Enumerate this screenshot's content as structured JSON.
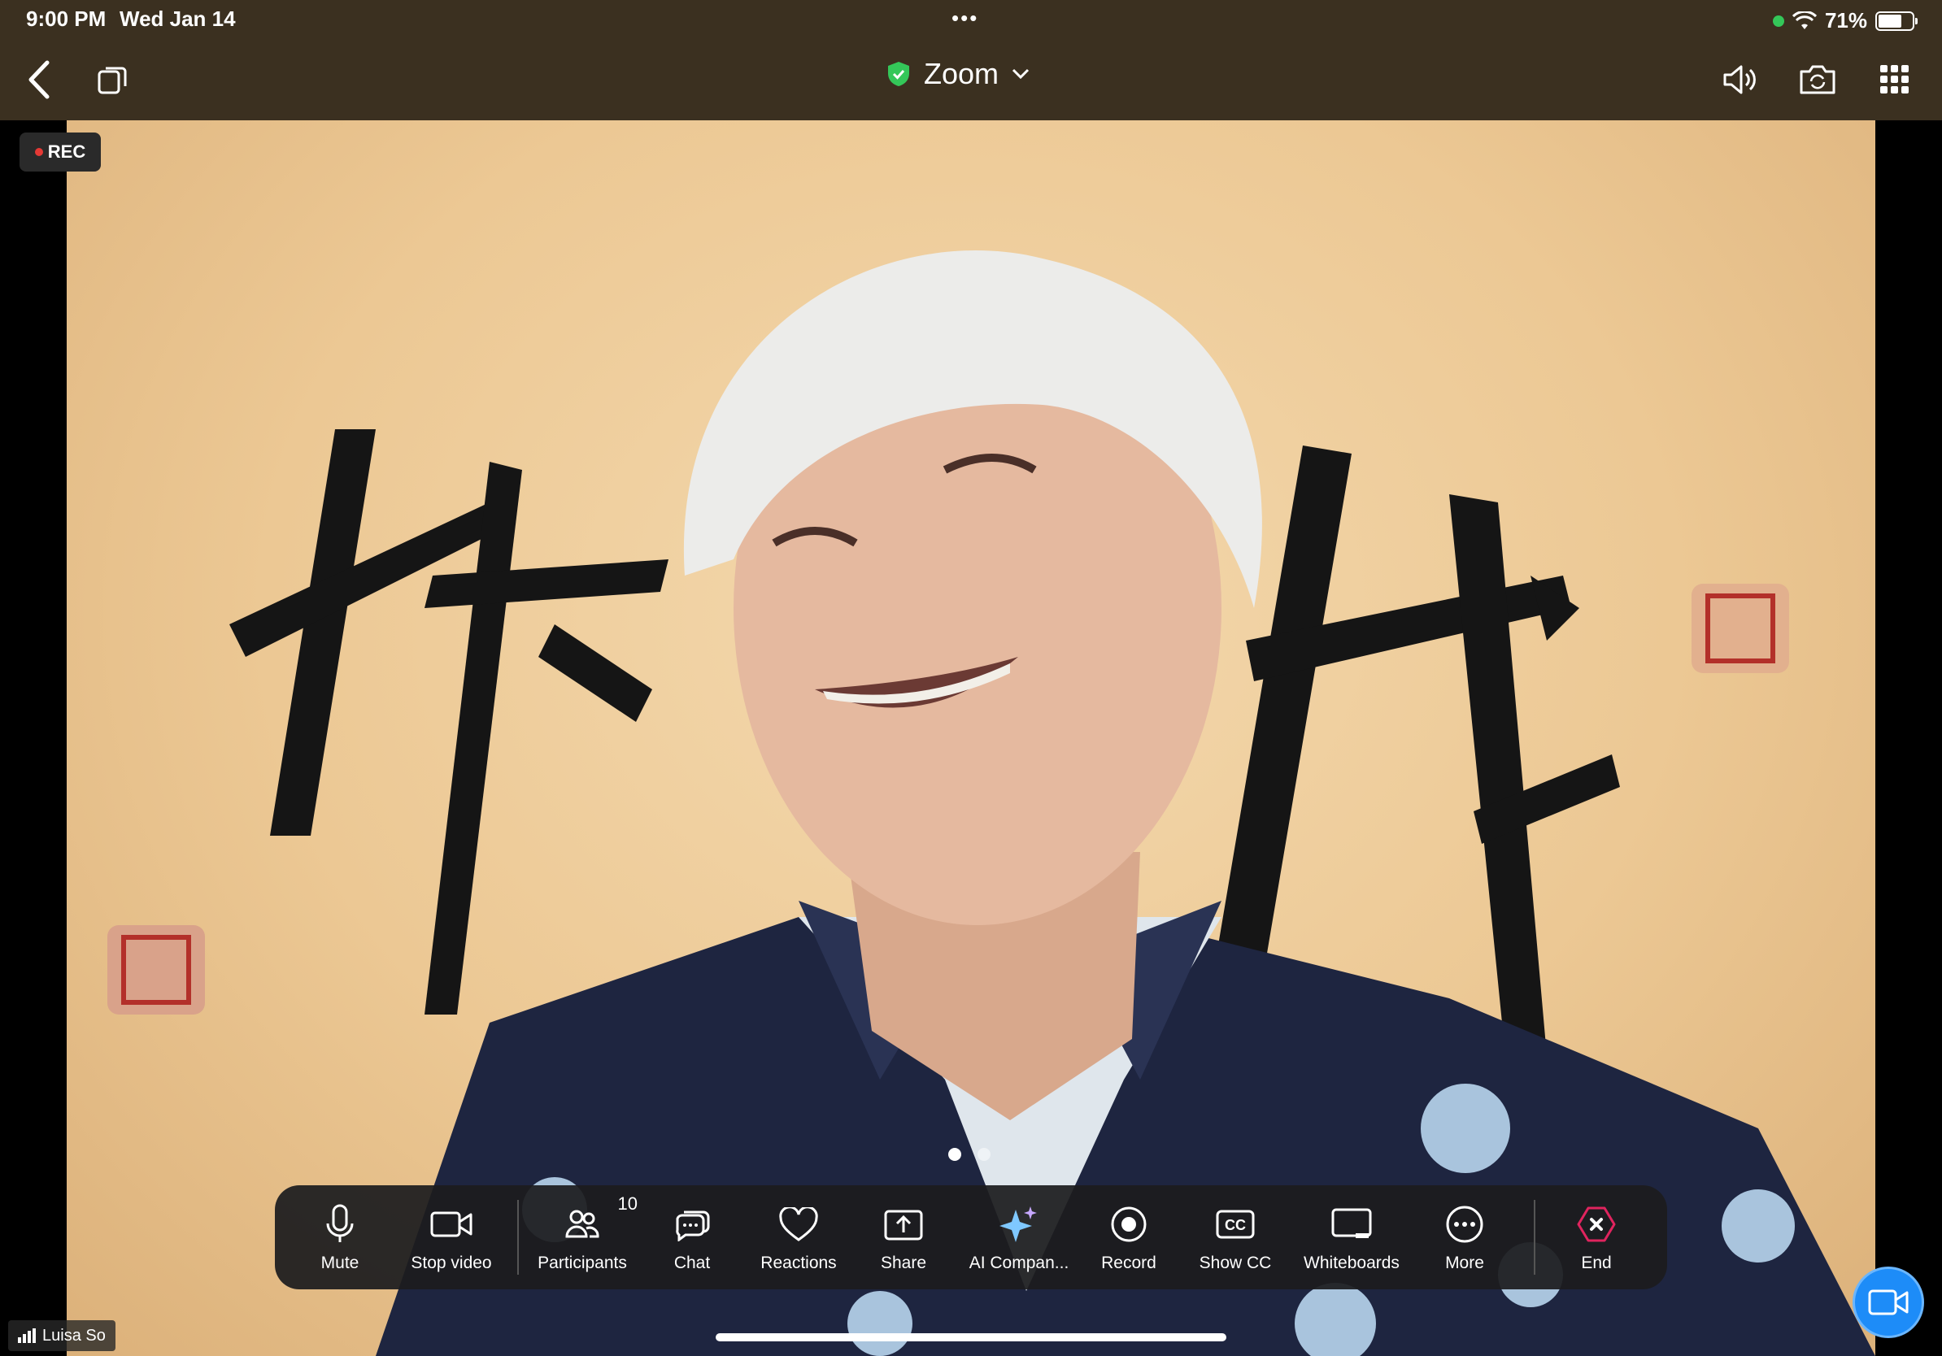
{
  "status_bar": {
    "time": "9:00 PM",
    "date": "Wed Jan 14",
    "battery": "71%",
    "battery_level": 0.71
  },
  "top_bar": {
    "title": "Zoom"
  },
  "video": {
    "rec_label": "REC",
    "participant_name": "Luisa So",
    "page_count": 2,
    "current_page": 1
  },
  "toolbar": {
    "items": [
      {
        "label": "Mute",
        "icon": "microphone-icon"
      },
      {
        "label": "Stop video",
        "icon": "video-camera-icon"
      },
      {
        "label": "Participants",
        "icon": "participants-icon",
        "badge": "10"
      },
      {
        "label": "Chat",
        "icon": "chat-icon"
      },
      {
        "label": "Reactions",
        "icon": "heart-icon"
      },
      {
        "label": "Share",
        "icon": "share-icon"
      },
      {
        "label": "AI Compan...",
        "icon": "sparkle-icon"
      },
      {
        "label": "Record",
        "icon": "record-icon"
      },
      {
        "label": "Show CC",
        "icon": "cc-icon"
      },
      {
        "label": "Whiteboards",
        "icon": "whiteboard-icon"
      },
      {
        "label": "More",
        "icon": "more-icon"
      },
      {
        "label": "End",
        "icon": "end-icon"
      }
    ]
  },
  "colors": {
    "bar_bg": "#3b3020",
    "toolbar_bg": "#1c1c1e",
    "end_red": "#e0245e",
    "shield_green": "#34c759",
    "fab_blue": "#1d8cf8"
  }
}
